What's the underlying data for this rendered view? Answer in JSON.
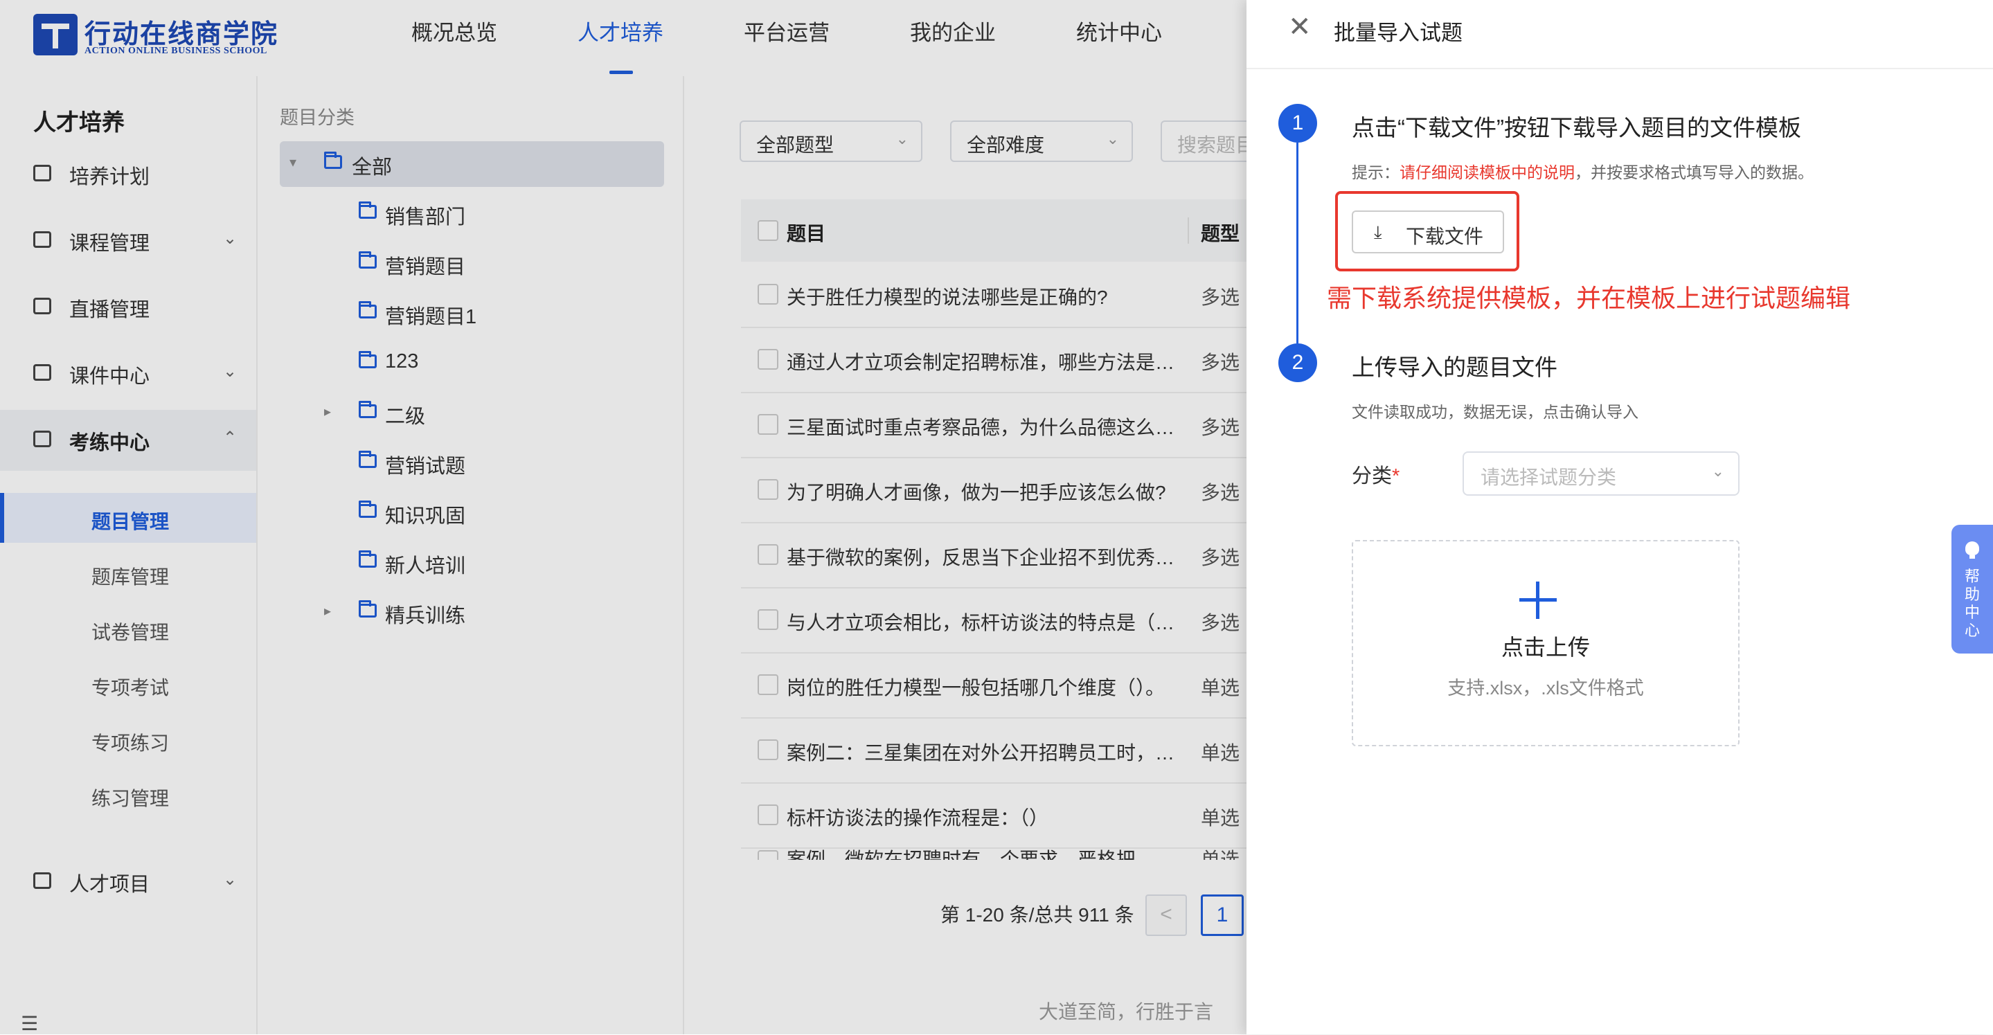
{
  "header": {
    "logo_main": "行动在线商学院",
    "logo_sub": "ACTION ONLINE BUSINESS SCHOOL",
    "nav": [
      "概况总览",
      "人才培养",
      "平台运营",
      "我的企业",
      "统计中心"
    ],
    "active_nav": "人才培养"
  },
  "sidebar": {
    "title": "人才培养",
    "menu": [
      {
        "label": "培养计划",
        "icon": "calendar-icon",
        "expandable": false
      },
      {
        "label": "课程管理",
        "icon": "book-icon",
        "expandable": true
      },
      {
        "label": "直播管理",
        "icon": "camera-icon",
        "expandable": false
      },
      {
        "label": "课件中心",
        "icon": "inbox-icon",
        "expandable": true
      },
      {
        "label": "考练中心",
        "icon": "exam-icon",
        "expandable": true,
        "open": true
      },
      {
        "label": "人才项目",
        "icon": "project-icon",
        "expandable": true
      }
    ],
    "submenu": [
      "题目管理",
      "题库管理",
      "试卷管理",
      "专项考试",
      "专项练习",
      "练习管理"
    ],
    "active_sub": "题目管理",
    "collapse_icon": "menu-collapse-icon"
  },
  "tree": {
    "title": "题目分类",
    "nodes": [
      {
        "label": "全部",
        "level": 0,
        "expanded": true,
        "selected": true
      },
      {
        "label": "销售部门",
        "level": 1
      },
      {
        "label": "营销题目",
        "level": 1
      },
      {
        "label": "营销题目1",
        "level": 1
      },
      {
        "label": "123",
        "level": 1
      },
      {
        "label": "二级",
        "level": 1,
        "has_children": true
      },
      {
        "label": "营销试题",
        "level": 1
      },
      {
        "label": "知识巩固",
        "level": 1
      },
      {
        "label": "新人培训",
        "level": 1
      },
      {
        "label": "精兵训练",
        "level": 1,
        "has_children": true
      }
    ]
  },
  "filters": {
    "type": "全部题型",
    "difficulty": "全部难度",
    "search_placeholder": "搜索题目"
  },
  "table": {
    "columns": [
      "题目",
      "题型"
    ],
    "rows": [
      {
        "question": "关于胜任力模型的说法哪些是正确的?",
        "type": "多选"
      },
      {
        "question": "通过人才立项会制定招聘标准，哪些方法是…",
        "type": "多选"
      },
      {
        "question": "三星面试时重点考察品德，为什么品德这么…",
        "type": "多选"
      },
      {
        "question": "为了明确人才画像，做为一把手应该怎么做?",
        "type": "多选"
      },
      {
        "question": "基于微软的案例，反思当下企业招不到优秀…",
        "type": "多选"
      },
      {
        "question": "与人才立项会相比，标杆访谈法的特点是（…",
        "type": "多选"
      },
      {
        "question": "岗位的胜任力模型一般包括哪几个维度（）。",
        "type": "单选"
      },
      {
        "question": "案例二：三星集团在对外公开招聘员工时，…",
        "type": "单选"
      },
      {
        "question": "标杆访谈法的操作流程是：（）",
        "type": "单选"
      },
      {
        "question": "案例…微软在招聘时有…个要求…严格把…",
        "type": "单选"
      }
    ]
  },
  "pagination": {
    "summary": "第 1-20 条/总共 911 条",
    "prev": "<",
    "current_page": "1"
  },
  "footer": {
    "motto": "大道至简，行胜于言"
  },
  "drawer": {
    "title": "批量导入试题",
    "close_icon": "close-icon",
    "step1": {
      "number": "1",
      "title": "点击“下载文件”按钮下载导入题目的文件模板",
      "hint_prefix": "提示：",
      "hint_emphasis": "请仔细阅读模板中的说明",
      "hint_suffix": "，并按要求格式填写导入的数据。",
      "download_label": "下载文件",
      "annotation": "需下载系统提供模板，并在模板上进行试题编辑"
    },
    "step2": {
      "number": "2",
      "title": "上传导入的题目文件",
      "subtitle": "文件读取成功，数据无误，点击确认导入",
      "category_label": "分类",
      "required_mark": "*",
      "category_placeholder": "请选择试题分类",
      "upload_label": "点击上传",
      "upload_formats": "支持.xlsx，.xls文件格式"
    }
  },
  "help": {
    "chars": [
      "帮",
      "助",
      "中",
      "心"
    ]
  },
  "colors": {
    "primary": "#1f5ddc",
    "brand": "#1e49b5",
    "annotation_red": "#e8382e",
    "help_tab": "#6b8df2"
  }
}
